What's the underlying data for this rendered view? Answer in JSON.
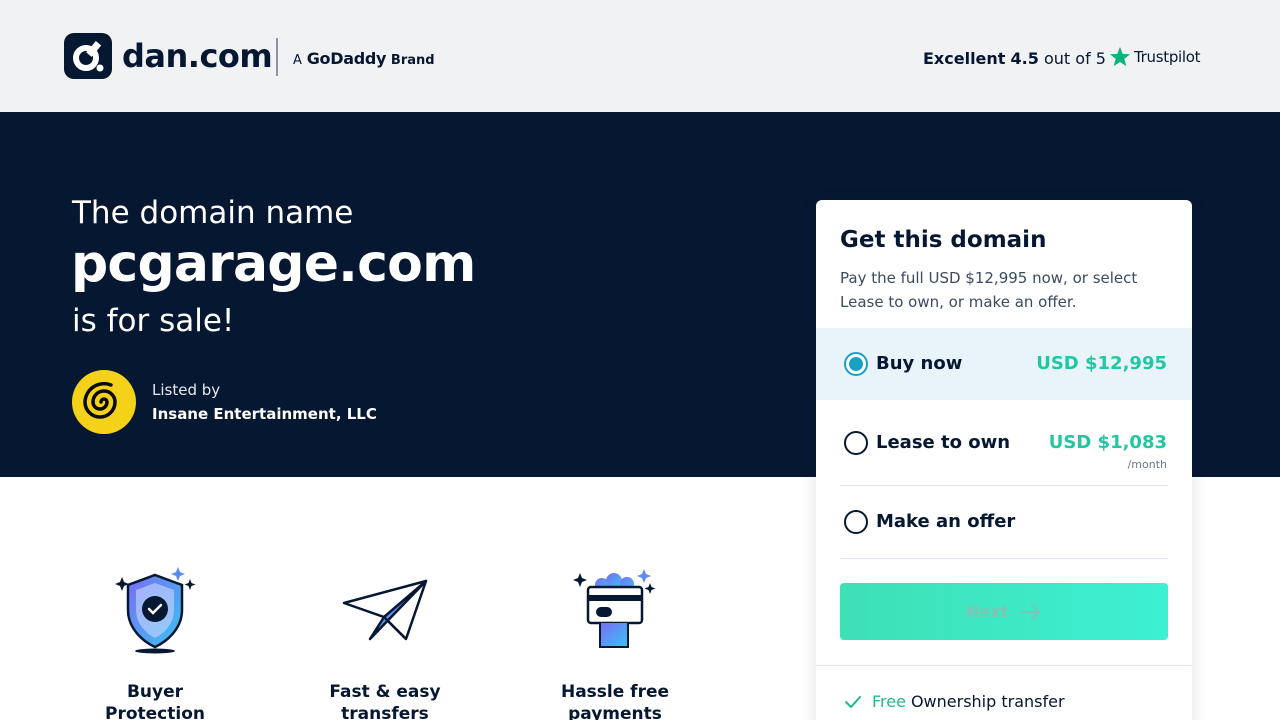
{
  "header": {
    "logo_text": "dan.com",
    "brand_prefix": "A",
    "brand_name": "GoDaddy",
    "brand_suffix": "Brand",
    "rating_label": "Excellent",
    "rating_value": "4.5",
    "rating_suffix": "out of 5",
    "trustpilot": "Trustpilot"
  },
  "hero": {
    "pre": "The domain name",
    "domain": "pcgarage.com",
    "post": "is for sale!",
    "listed_by_label": "Listed by",
    "seller_name": "Insane Entertainment, LLC"
  },
  "card": {
    "title": "Get this domain",
    "description": "Pay the full USD $12,995 now, or select Lease to own, or make an offer.",
    "options": [
      {
        "label": "Buy now",
        "price": "USD $12,995",
        "sub": "",
        "selected": true
      },
      {
        "label": "Lease to own",
        "price": "USD $1,083",
        "sub": "/month",
        "selected": false
      },
      {
        "label": "Make an offer",
        "price": "",
        "sub": "",
        "selected": false
      }
    ],
    "next_label": "Next",
    "feature_free": "Free",
    "feature_text": "Ownership transfer"
  },
  "perks": [
    {
      "label": "Buyer Protection program",
      "icon": "shield-check-icon"
    },
    {
      "label": "Fast & easy transfers",
      "icon": "paper-plane-icon"
    },
    {
      "label": "Hassle free payments",
      "icon": "payment-card-icon"
    }
  ],
  "colors": {
    "navy": "#061732",
    "accent_teal": "#17a0c4",
    "price_green": "#23c6a2",
    "trustpilot_green": "#00b67a"
  }
}
